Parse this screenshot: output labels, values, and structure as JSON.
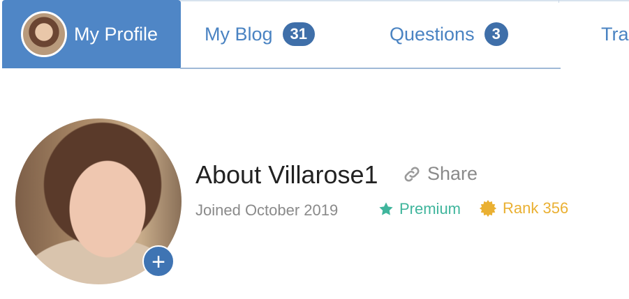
{
  "tabs": {
    "profile": {
      "label": "My Profile"
    },
    "blog": {
      "label": "My Blog",
      "count": "31"
    },
    "questions": {
      "label": "Questions",
      "count": "3"
    },
    "more": {
      "label": "Tra"
    }
  },
  "profile": {
    "title": "About Villarose1",
    "share_label": "Share",
    "joined": "Joined October 2019",
    "premium_label": "Premium",
    "rank_label": "Rank 356",
    "add_button_label": "+"
  },
  "colors": {
    "primary": "#4f86c6",
    "badge": "#3f6fa9",
    "premium": "#3fb59c",
    "rank": "#eab032"
  },
  "icons": [
    "avatar",
    "link-icon",
    "star-icon",
    "rank-badge-icon",
    "plus-icon"
  ]
}
